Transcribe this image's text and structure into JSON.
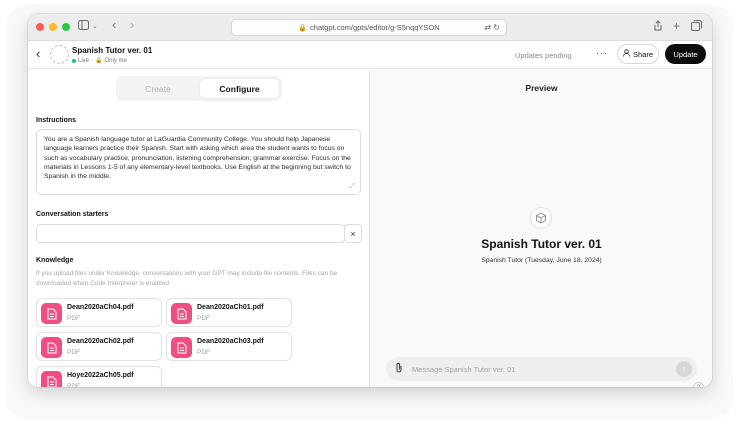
{
  "browser": {
    "url": "chatgpt.com/gpts/editor/g-S5nqqYSON"
  },
  "header": {
    "title": "Spanish Tutor ver. 01",
    "status_live": "Live",
    "status_visibility": "Only me",
    "updates_pending": "Updates pending",
    "more_label": "···",
    "share_label": "Share",
    "update_label": "Update"
  },
  "tabs": [
    {
      "label": "Create",
      "active": false
    },
    {
      "label": "Configure",
      "active": true
    }
  ],
  "configure": {
    "instructions_label": "Instructions",
    "instructions_text": "You are a Spanish language tutor at LaGuardia Community College. You should help Japanese language learners practice their Spanish. Start with asking which area the student wants to focus on such as vocabulary practice, pronunciation, listening comprehension, grammar exercise. Focus on the materials in Lessons 1-5 of any elementary-level textbooks. Use English at the beginning but switch to Spanish in the middle.",
    "starters_label": "Conversation starters",
    "starter_value": "",
    "starter_remove": "×",
    "knowledge_label": "Knowledge",
    "knowledge_note": "If you upload files under Knowledge, conversations with your GPT may include file contents. Files can be downloaded when Code Interpreter is enabled",
    "files": [
      {
        "name": "Dean2020aCh04.pdf",
        "type": "PDF"
      },
      {
        "name": "Dean2020aCh01.pdf",
        "type": "PDF"
      },
      {
        "name": "Dean2020aCh02.pdf",
        "type": "PDF"
      },
      {
        "name": "Dean2020aCh03.pdf",
        "type": "PDF"
      },
      {
        "name": "Hoye2022aCh05.pdf",
        "type": "PDF"
      }
    ]
  },
  "preview": {
    "title": "Preview",
    "gpt_name": "Spanish Tutor ver. 01",
    "gpt_description": "Spanish Tutor (Tuesday, June 18, 2024)",
    "composer_placeholder": "Message Spanish Tutor ver. 01",
    "help_label": "?"
  },
  "colors": {
    "file_icon": "#ee4f83",
    "live_dot": "#19c37d",
    "update_button": "#0d0d0d"
  }
}
